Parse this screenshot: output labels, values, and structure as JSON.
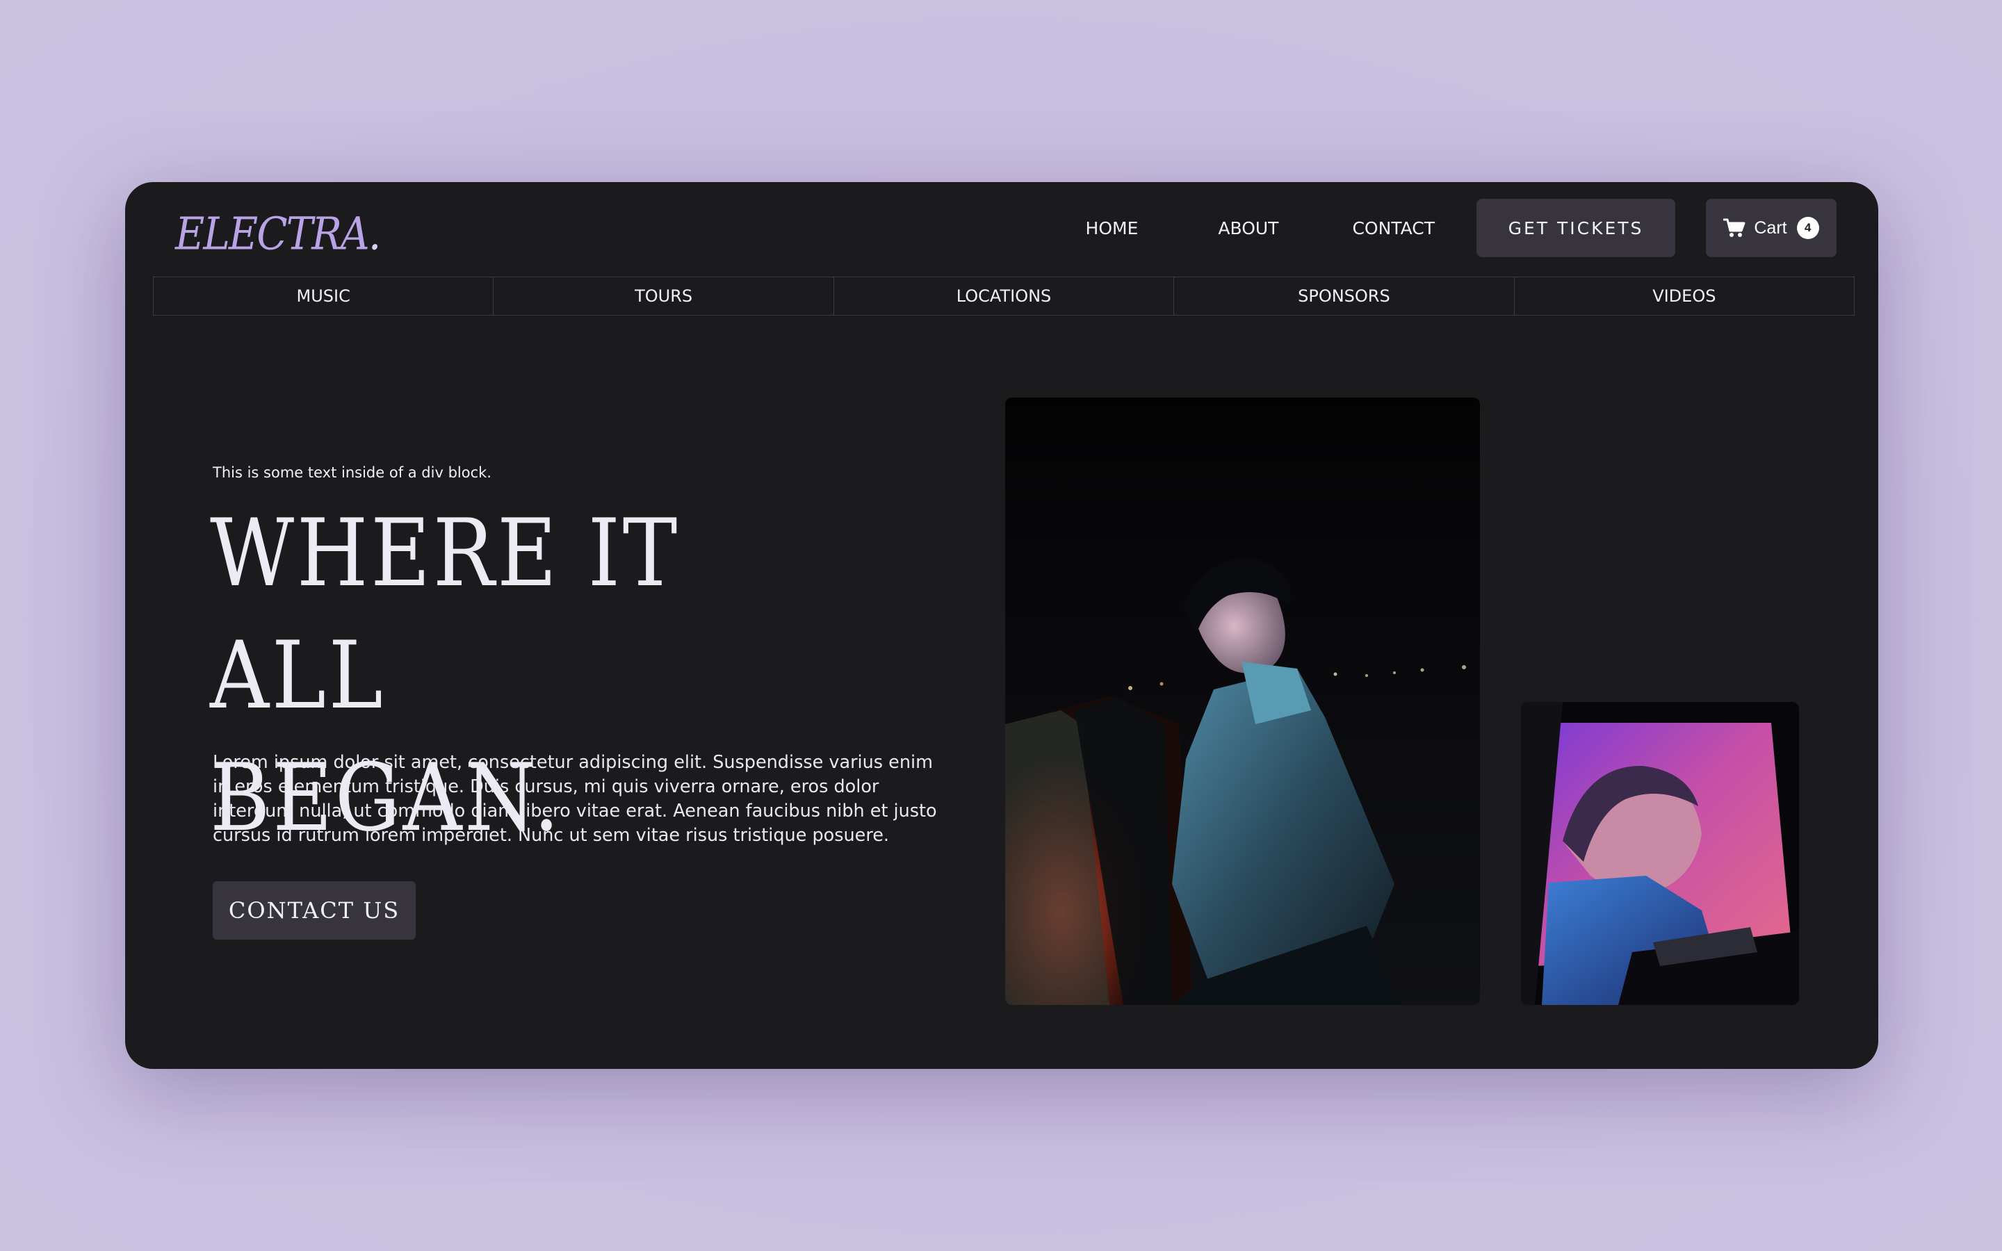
{
  "brand": {
    "logo_text": "ELECTRA",
    "logo_dot": ".",
    "logo_color": "#b9a3e6"
  },
  "top_nav": {
    "links": [
      "HOME",
      "ABOUT",
      "CONTACT"
    ],
    "tickets_label": "GET TICKETS",
    "cart_label": "Cart",
    "cart_count": "4",
    "cart_icon": "cart-icon"
  },
  "sub_nav": {
    "items": [
      "MUSIC",
      "TOURS",
      "LOCATIONS",
      "SPONSORS",
      "VIDEOS"
    ]
  },
  "hero": {
    "eyebrow": "This is some text inside of a div block.",
    "title_line1": "WHERE IT ALL",
    "title_line2": "BEGAN.",
    "body": "Lorem ipsum dolor sit amet, consectetur adipiscing elit. Suspendisse varius enim in eros elementum tristique. Duis cursus, mi quis viverra ornare, eros dolor interdum nulla, ut commodo diam libero vitae erat. Aenean faucibus nibh et justo cursus id rutrum lorem imperdiet. Nunc ut sem vitae risus tristique posuere.",
    "cta_label": "CONTACT US"
  },
  "colors": {
    "page_background": "#c9bfe0",
    "window_background": "#1b1b1e",
    "button_background": "#37343d",
    "text": "#f3f1f8"
  }
}
